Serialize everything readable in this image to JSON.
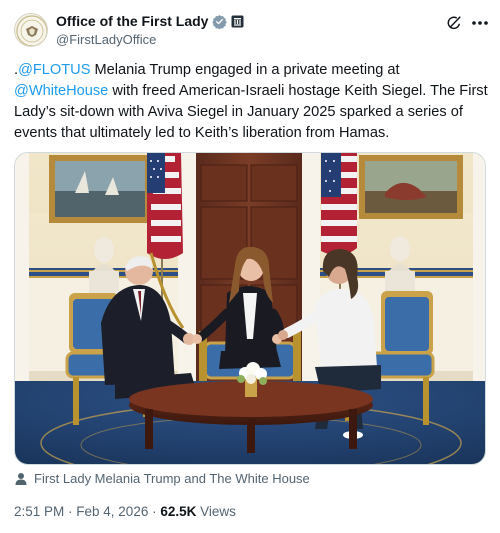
{
  "author": {
    "display_name": "Office of the First Lady",
    "handle": "@FirstLadyOffice",
    "verified_badge": "gray-verified-badge",
    "affiliation_badge": "government-affiliation-badge"
  },
  "tweet": {
    "text_parts": [
      {
        "text": ".",
        "type": "text"
      },
      {
        "text": "@FLOTUS",
        "type": "mention"
      },
      {
        "text": " Melania Trump engaged in a private meeting at ",
        "type": "text"
      },
      {
        "text": "@WhiteHouse",
        "type": "mention"
      },
      {
        "text": " with freed American-Israeli hostage Keith Siegel. The First Lady’s sit-down with Aviva Siegel in January 2025 sparked a series of events that ultimately led to Keith’s liberation from Hamas.",
        "type": "text"
      }
    ]
  },
  "media": {
    "caption": "First Lady Melania Trump and The White House",
    "caption_icon": "person-icon"
  },
  "meta": {
    "time": "2:51 PM",
    "separator": " · ",
    "date": "Feb 4, 2026",
    "views_count": "62.5K",
    "views_label": "Views"
  },
  "colors": {
    "link": "#1d9bf0",
    "secondary_text": "#536471",
    "primary_text": "#0f1419",
    "wall": "#f3e8c8",
    "carpet": "#1f3f6b",
    "chair_upholstery": "#3b6ea8",
    "gilt": "#c9a24a"
  }
}
